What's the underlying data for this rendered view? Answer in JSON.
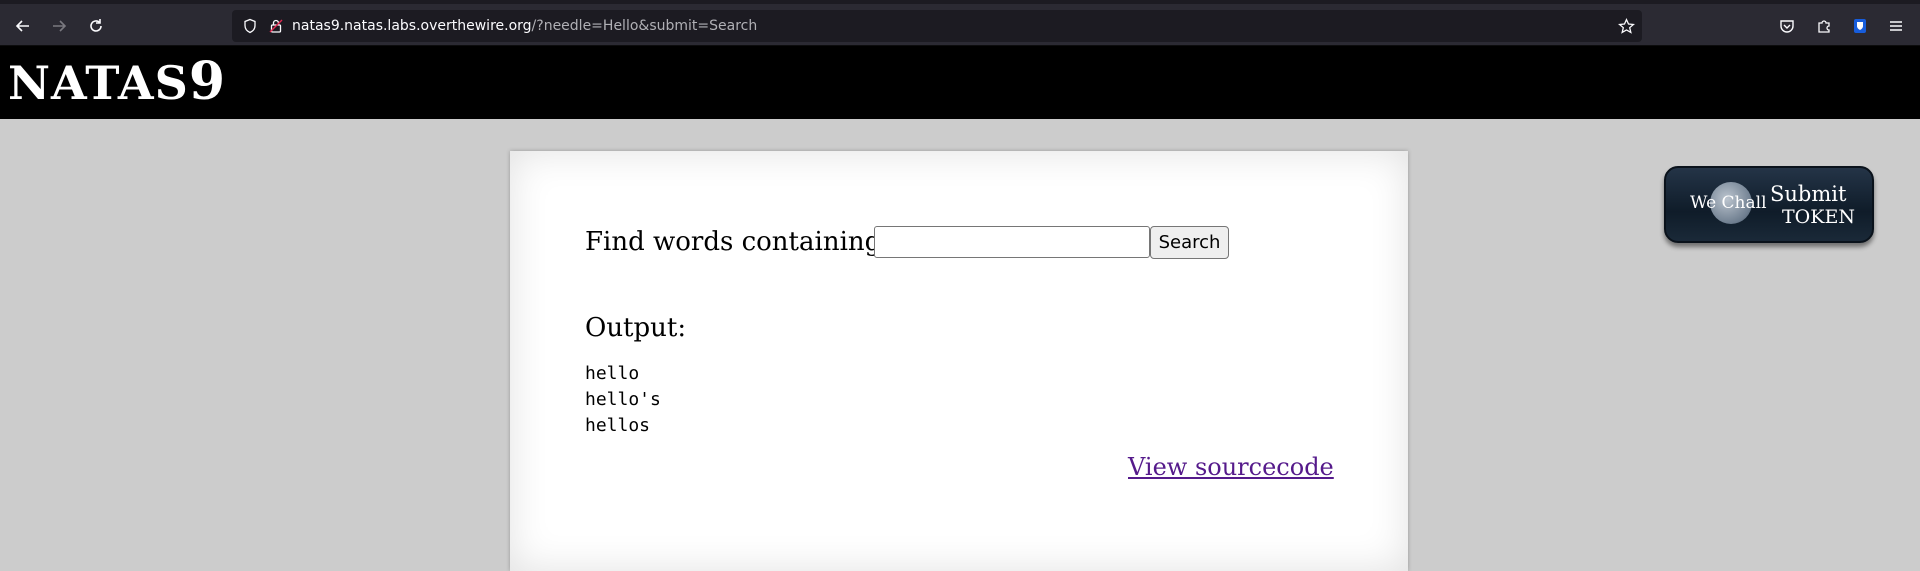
{
  "browser": {
    "url_host": "natas9.natas.labs.overthewire.org",
    "url_path": "/?needle=Hello&submit=Search"
  },
  "header": {
    "logo_text": "NATAS",
    "logo_number": "9"
  },
  "form": {
    "find_label": "Find words containing:",
    "needle_value": "",
    "search_button_label": "Search"
  },
  "output": {
    "label": "Output:",
    "results": [
      "hello",
      "hello's",
      "hellos"
    ]
  },
  "links": {
    "view_sourcecode": "View sourcecode"
  },
  "token_badge": {
    "brand": "We Chall",
    "line1": "Submit",
    "line2": "TOKEN"
  },
  "colors": {
    "page_background": "#cccccc",
    "header_background": "#000000",
    "link_visited": "#551a8b"
  }
}
